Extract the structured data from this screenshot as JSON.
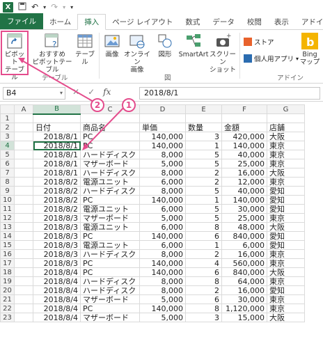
{
  "quick_access": {
    "app_icon": "X"
  },
  "tabs": [
    "ファイル",
    "ホーム",
    "挿入",
    "ページ レイアウト",
    "数式",
    "データ",
    "校閲",
    "表示",
    "アドイン"
  ],
  "ribbon": {
    "pivot_line1": "ピボット",
    "pivot_line2": "テーブル",
    "recommended_line1": "おすすめ",
    "recommended_line2": "ピボットテーブル",
    "table_label": "テーブル",
    "group_table": "テーブル",
    "image_label": "画像",
    "online_image_line1": "オンライン",
    "online_image_line2": "画像",
    "shapes_label": "図形",
    "smartart_label": "SmartArt",
    "screenshot_line1": "スクリーン",
    "screenshot_line2": "ショット",
    "group_figure": "図",
    "store_label": "ストア",
    "personal_apps_label": "個人用アプリ",
    "bing_line1": "Bing",
    "bing_line2": "マップ",
    "group_addin": "アドイン"
  },
  "formula_bar": {
    "name_box": "B4",
    "formula": "2018/8/1"
  },
  "sheet": {
    "columns": [
      "A",
      "B",
      "C",
      "D",
      "E",
      "F",
      "G"
    ],
    "rows": [
      [
        "",
        "",
        "",
        "",
        "",
        "",
        ""
      ],
      [
        "",
        "日付",
        "商品名",
        "単価",
        "数量",
        "金額",
        "店舗"
      ],
      [
        "",
        "2018/8/1",
        "PC",
        "140,000",
        "3",
        "420,000",
        "大阪"
      ],
      [
        "",
        "2018/8/1",
        "PC",
        "140,000",
        "1",
        "140,000",
        "東京"
      ],
      [
        "",
        "2018/8/1",
        "ハードディスク",
        "8,000",
        "5",
        "40,000",
        "東京"
      ],
      [
        "",
        "2018/8/1",
        "マザーボード",
        "5,000",
        "5",
        "25,000",
        "東京"
      ],
      [
        "",
        "2018/8/1",
        "ハードディスク",
        "8,000",
        "2",
        "16,000",
        "大阪"
      ],
      [
        "",
        "2018/8/2",
        "電源ユニット",
        "6,000",
        "2",
        "12,000",
        "東京"
      ],
      [
        "",
        "2018/8/2",
        "ハードディスク",
        "8,000",
        "5",
        "40,000",
        "愛知"
      ],
      [
        "",
        "2018/8/2",
        "PC",
        "140,000",
        "1",
        "140,000",
        "愛知"
      ],
      [
        "",
        "2018/8/2",
        "電源ユニット",
        "6,000",
        "5",
        "30,000",
        "愛知"
      ],
      [
        "",
        "2018/8/3",
        "マザーボード",
        "5,000",
        "5",
        "25,000",
        "東京"
      ],
      [
        "",
        "2018/8/3",
        "電源ユニット",
        "6,000",
        "8",
        "48,000",
        "大阪"
      ],
      [
        "",
        "2018/8/3",
        "PC",
        "140,000",
        "6",
        "840,000",
        "愛知"
      ],
      [
        "",
        "2018/8/3",
        "電源ユニット",
        "6,000",
        "1",
        "6,000",
        "愛知"
      ],
      [
        "",
        "2018/8/3",
        "ハードディスク",
        "8,000",
        "2",
        "16,000",
        "東京"
      ],
      [
        "",
        "2018/8/3",
        "PC",
        "140,000",
        "4",
        "560,000",
        "東京"
      ],
      [
        "",
        "2018/8/4",
        "PC",
        "140,000",
        "6",
        "840,000",
        "大阪"
      ],
      [
        "",
        "2018/8/4",
        "ハードディスク",
        "8,000",
        "8",
        "64,000",
        "東京"
      ],
      [
        "",
        "2018/8/4",
        "ハードディスク",
        "8,000",
        "2",
        "16,000",
        "愛知"
      ],
      [
        "",
        "2018/8/4",
        "マザーボード",
        "5,000",
        "6",
        "30,000",
        "東京"
      ],
      [
        "",
        "2018/8/4",
        "PC",
        "140,000",
        "8",
        "1,120,000",
        "東京"
      ],
      [
        "",
        "2018/8/4",
        "マザーボード",
        "5,000",
        "3",
        "15,000",
        "大阪"
      ]
    ]
  },
  "annotations": {
    "step1": "1",
    "step2": "2"
  },
  "colors": {
    "excel_green": "#217346",
    "annotation_pink": "#e44c8c"
  }
}
